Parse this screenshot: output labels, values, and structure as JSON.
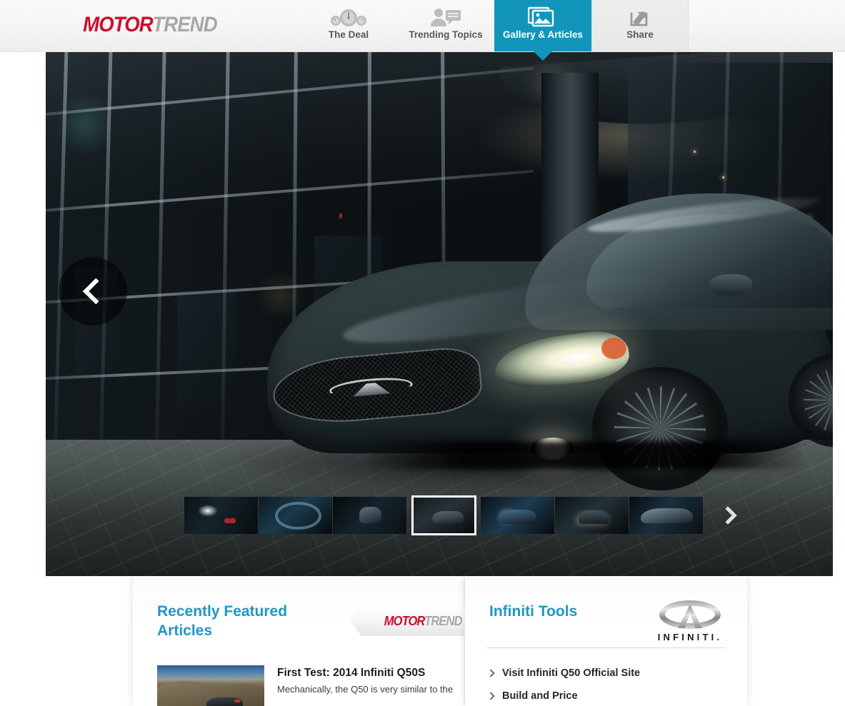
{
  "header": {
    "brand": {
      "part1": "MOTOR",
      "part2": "TREND"
    },
    "tabs": [
      {
        "id": "the-deal",
        "label": "The Deal",
        "icon": "gauges-icon",
        "active": false
      },
      {
        "id": "trending-topics",
        "label": "Trending Topics",
        "icon": "person-chat-icon",
        "active": false
      },
      {
        "id": "gallery-articles",
        "label": "Gallery & Articles",
        "icon": "photos-icon",
        "active": true
      },
      {
        "id": "share",
        "label": "Share",
        "icon": "share-icon",
        "active": false
      }
    ],
    "accent_color": "#1295ba",
    "brand_red": "#c8102e",
    "brand_gray": "#a8a8a8"
  },
  "gallery": {
    "prev_arrow": "chevron-left-icon",
    "next_arrow": "chevron-right-icon",
    "hero_alt": "2014 Infiniti Q50S sedan parked at night outside a glass office building",
    "selected_index": 3,
    "thumbnails": [
      {
        "id": "thumb-1",
        "alt": "Rear taillights of Infiniti Q50 at night"
      },
      {
        "id": "thumb-2",
        "alt": "Steering wheel and driver door interior"
      },
      {
        "id": "thumb-3",
        "alt": "Hand on gear shifter in center console"
      },
      {
        "id": "thumb-4",
        "alt": "Infiniti Q50 three-quarter view by columns"
      },
      {
        "id": "thumb-5",
        "alt": "Q50 driving with headlights on"
      },
      {
        "id": "thumb-6",
        "alt": "Front view of Q50 on city street"
      },
      {
        "id": "thumb-7",
        "alt": "Q50 side profile at night"
      }
    ]
  },
  "articles_panel": {
    "title": "Recently Featured Articles",
    "ribbon_brand": {
      "part1": "MOTOR",
      "part2": "TREND"
    },
    "title_color": "#1f97c4",
    "articles": [
      {
        "title": "First Test: 2014 Infiniti Q50S",
        "excerpt": "Mechanically, the Q50 is very similar to the",
        "thumb_alt": "Infiniti Q50 on a desert mountain road"
      }
    ]
  },
  "tools_panel": {
    "title": "Infiniti Tools",
    "title_color": "#1f97c4",
    "badge": {
      "wordmark": "INFINITI.",
      "mark": "infiniti-logo-icon"
    },
    "links": [
      {
        "id": "visit-official-site",
        "label": "Visit Infiniti Q50 Official Site",
        "icon": "chevron-right-icon"
      },
      {
        "id": "build-and-price",
        "label": "Build and Price",
        "icon": "chevron-right-icon"
      }
    ]
  }
}
